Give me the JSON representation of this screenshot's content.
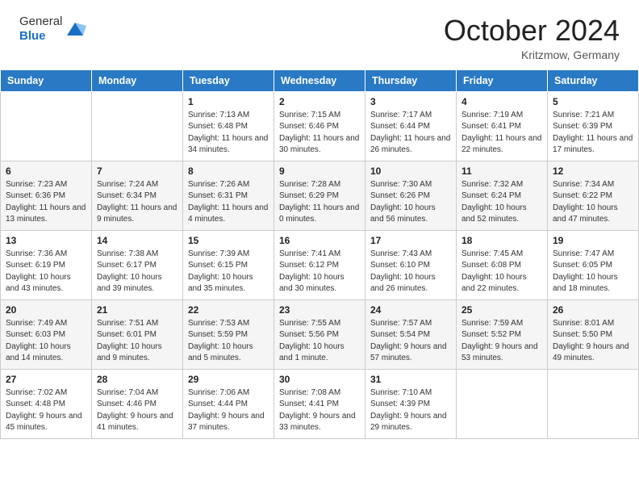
{
  "header": {
    "logo_general": "General",
    "logo_blue": "Blue",
    "month_title": "October 2024",
    "subtitle": "Kritzmow, Germany"
  },
  "weekdays": [
    "Sunday",
    "Monday",
    "Tuesday",
    "Wednesday",
    "Thursday",
    "Friday",
    "Saturday"
  ],
  "weeks": [
    [
      {
        "day": "",
        "sunrise": "",
        "sunset": "",
        "daylight": ""
      },
      {
        "day": "",
        "sunrise": "",
        "sunset": "",
        "daylight": ""
      },
      {
        "day": "1",
        "sunrise": "Sunrise: 7:13 AM",
        "sunset": "Sunset: 6:48 PM",
        "daylight": "Daylight: 11 hours and 34 minutes."
      },
      {
        "day": "2",
        "sunrise": "Sunrise: 7:15 AM",
        "sunset": "Sunset: 6:46 PM",
        "daylight": "Daylight: 11 hours and 30 minutes."
      },
      {
        "day": "3",
        "sunrise": "Sunrise: 7:17 AM",
        "sunset": "Sunset: 6:44 PM",
        "daylight": "Daylight: 11 hours and 26 minutes."
      },
      {
        "day": "4",
        "sunrise": "Sunrise: 7:19 AM",
        "sunset": "Sunset: 6:41 PM",
        "daylight": "Daylight: 11 hours and 22 minutes."
      },
      {
        "day": "5",
        "sunrise": "Sunrise: 7:21 AM",
        "sunset": "Sunset: 6:39 PM",
        "daylight": "Daylight: 11 hours and 17 minutes."
      }
    ],
    [
      {
        "day": "6",
        "sunrise": "Sunrise: 7:23 AM",
        "sunset": "Sunset: 6:36 PM",
        "daylight": "Daylight: 11 hours and 13 minutes."
      },
      {
        "day": "7",
        "sunrise": "Sunrise: 7:24 AM",
        "sunset": "Sunset: 6:34 PM",
        "daylight": "Daylight: 11 hours and 9 minutes."
      },
      {
        "day": "8",
        "sunrise": "Sunrise: 7:26 AM",
        "sunset": "Sunset: 6:31 PM",
        "daylight": "Daylight: 11 hours and 4 minutes."
      },
      {
        "day": "9",
        "sunrise": "Sunrise: 7:28 AM",
        "sunset": "Sunset: 6:29 PM",
        "daylight": "Daylight: 11 hours and 0 minutes."
      },
      {
        "day": "10",
        "sunrise": "Sunrise: 7:30 AM",
        "sunset": "Sunset: 6:26 PM",
        "daylight": "Daylight: 10 hours and 56 minutes."
      },
      {
        "day": "11",
        "sunrise": "Sunrise: 7:32 AM",
        "sunset": "Sunset: 6:24 PM",
        "daylight": "Daylight: 10 hours and 52 minutes."
      },
      {
        "day": "12",
        "sunrise": "Sunrise: 7:34 AM",
        "sunset": "Sunset: 6:22 PM",
        "daylight": "Daylight: 10 hours and 47 minutes."
      }
    ],
    [
      {
        "day": "13",
        "sunrise": "Sunrise: 7:36 AM",
        "sunset": "Sunset: 6:19 PM",
        "daylight": "Daylight: 10 hours and 43 minutes."
      },
      {
        "day": "14",
        "sunrise": "Sunrise: 7:38 AM",
        "sunset": "Sunset: 6:17 PM",
        "daylight": "Daylight: 10 hours and 39 minutes."
      },
      {
        "day": "15",
        "sunrise": "Sunrise: 7:39 AM",
        "sunset": "Sunset: 6:15 PM",
        "daylight": "Daylight: 10 hours and 35 minutes."
      },
      {
        "day": "16",
        "sunrise": "Sunrise: 7:41 AM",
        "sunset": "Sunset: 6:12 PM",
        "daylight": "Daylight: 10 hours and 30 minutes."
      },
      {
        "day": "17",
        "sunrise": "Sunrise: 7:43 AM",
        "sunset": "Sunset: 6:10 PM",
        "daylight": "Daylight: 10 hours and 26 minutes."
      },
      {
        "day": "18",
        "sunrise": "Sunrise: 7:45 AM",
        "sunset": "Sunset: 6:08 PM",
        "daylight": "Daylight: 10 hours and 22 minutes."
      },
      {
        "day": "19",
        "sunrise": "Sunrise: 7:47 AM",
        "sunset": "Sunset: 6:05 PM",
        "daylight": "Daylight: 10 hours and 18 minutes."
      }
    ],
    [
      {
        "day": "20",
        "sunrise": "Sunrise: 7:49 AM",
        "sunset": "Sunset: 6:03 PM",
        "daylight": "Daylight: 10 hours and 14 minutes."
      },
      {
        "day": "21",
        "sunrise": "Sunrise: 7:51 AM",
        "sunset": "Sunset: 6:01 PM",
        "daylight": "Daylight: 10 hours and 9 minutes."
      },
      {
        "day": "22",
        "sunrise": "Sunrise: 7:53 AM",
        "sunset": "Sunset: 5:59 PM",
        "daylight": "Daylight: 10 hours and 5 minutes."
      },
      {
        "day": "23",
        "sunrise": "Sunrise: 7:55 AM",
        "sunset": "Sunset: 5:56 PM",
        "daylight": "Daylight: 10 hours and 1 minute."
      },
      {
        "day": "24",
        "sunrise": "Sunrise: 7:57 AM",
        "sunset": "Sunset: 5:54 PM",
        "daylight": "Daylight: 9 hours and 57 minutes."
      },
      {
        "day": "25",
        "sunrise": "Sunrise: 7:59 AM",
        "sunset": "Sunset: 5:52 PM",
        "daylight": "Daylight: 9 hours and 53 minutes."
      },
      {
        "day": "26",
        "sunrise": "Sunrise: 8:01 AM",
        "sunset": "Sunset: 5:50 PM",
        "daylight": "Daylight: 9 hours and 49 minutes."
      }
    ],
    [
      {
        "day": "27",
        "sunrise": "Sunrise: 7:02 AM",
        "sunset": "Sunset: 4:48 PM",
        "daylight": "Daylight: 9 hours and 45 minutes."
      },
      {
        "day": "28",
        "sunrise": "Sunrise: 7:04 AM",
        "sunset": "Sunset: 4:46 PM",
        "daylight": "Daylight: 9 hours and 41 minutes."
      },
      {
        "day": "29",
        "sunrise": "Sunrise: 7:06 AM",
        "sunset": "Sunset: 4:44 PM",
        "daylight": "Daylight: 9 hours and 37 minutes."
      },
      {
        "day": "30",
        "sunrise": "Sunrise: 7:08 AM",
        "sunset": "Sunset: 4:41 PM",
        "daylight": "Daylight: 9 hours and 33 minutes."
      },
      {
        "day": "31",
        "sunrise": "Sunrise: 7:10 AM",
        "sunset": "Sunset: 4:39 PM",
        "daylight": "Daylight: 9 hours and 29 minutes."
      },
      {
        "day": "",
        "sunrise": "",
        "sunset": "",
        "daylight": ""
      },
      {
        "day": "",
        "sunrise": "",
        "sunset": "",
        "daylight": ""
      }
    ]
  ]
}
